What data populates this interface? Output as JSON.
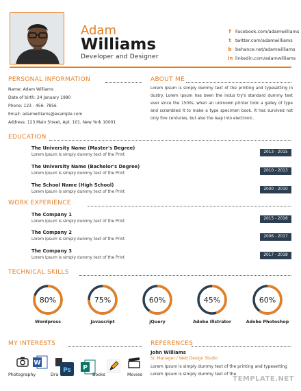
{
  "header": {
    "first_name": "Adam",
    "last_name": "Williams",
    "title": "Developer and Designer",
    "social": [
      {
        "icon": "facebook-icon",
        "glyph": "f",
        "text": "Facebook.com/adamwilliams"
      },
      {
        "icon": "twitter-icon",
        "glyph": "t",
        "text": "twitter.com/adamwilliams"
      },
      {
        "icon": "behance-icon",
        "glyph": "b",
        "text": "behance.net/adamwilliams"
      },
      {
        "icon": "linkedin-icon",
        "glyph": "in",
        "text": "linkedin.com/adamwilliams"
      }
    ]
  },
  "personal": {
    "heading": "PERSONAL INFORMATION",
    "lines": [
      "Name: Adam Williams",
      "Date of birth: 24 January 1980",
      "Phone: 123 - 456- 7856",
      "Email: adamwilliams@example.com",
      "Address:  123 Main Street, Apt. 101, New York 10001"
    ]
  },
  "about": {
    "heading": "ABOUT ME",
    "text": "Lorem Ipsum is simply dummy text of the printing and typesetting in dustry. Lorem Ipsum has been the indus try's standard dummy text ever since the 1500s, when an unknown printer took a galley of type and scrambled it to make a type specimen book. It has survived not only five centuries, but also the leap into electronic."
  },
  "education": {
    "heading": "EDUCATION",
    "items": [
      {
        "title": "The University Name (Master's Degree)",
        "desc": "Lorem Ipsum is simply dummy text of the Print",
        "years": "2013 - 2015"
      },
      {
        "title": "The University Name (Bachelor's Degree)",
        "desc": "Lorem Ipsum is simply dummy text of the Print",
        "years": "2010 - 2013"
      },
      {
        "title": "The School Name (High School)",
        "desc": "Lorem Ipsum is simply dummy text of the Print",
        "years": "2000 - 2010"
      }
    ]
  },
  "work": {
    "heading": "WORK EXPERIENCE",
    "items": [
      {
        "title": "The Company 1",
        "desc": "Lorem Ipsum is simply dummy text of the Print",
        "years": "2015 - 2016"
      },
      {
        "title": "The Company 2",
        "desc": "Lorem Ipsum is simply dummy text of the Print",
        "years": "2006 - 2017"
      },
      {
        "title": "The Company 3",
        "desc": "Lorem Ipsum is simply dummy text of the Print",
        "years": "2017 - 2018"
      }
    ]
  },
  "skills": {
    "heading": "TECHNICAL SKILLS",
    "items": [
      {
        "name": "Wordpress",
        "percent": 80,
        "label": "80%"
      },
      {
        "name": "Javascript",
        "percent": 75,
        "label": "75%"
      },
      {
        "name": "jQuery",
        "percent": 60,
        "label": "60%"
      },
      {
        "name": "Adobe Illstrator",
        "percent": 45,
        "label": "45%"
      },
      {
        "name": "Adobe Photoshop",
        "percent": 60,
        "label": "60%"
      }
    ],
    "ring_color": "#e67e22",
    "track_color": "#2c3e50"
  },
  "interests": {
    "heading": "MY INTERESTS",
    "items": [
      {
        "icon": "camera-icon",
        "label": "Photography"
      },
      {
        "icon": "word-icon",
        "label": "Dra"
      },
      {
        "icon": "photoshop-icon",
        "label": ""
      },
      {
        "icon": "publisher-icon",
        "label": "Books"
      },
      {
        "icon": "pencil-icon",
        "label": ""
      },
      {
        "icon": "movie-clapper-icon",
        "label": "Movies"
      }
    ]
  },
  "references": {
    "heading": "REFERENCES",
    "name": "John Williams",
    "role": "Sr. Manager / Web Design Studio",
    "lines": [
      "Lorem Ipsum is simply dummy text of the printing and typesetting",
      "Lorem Ipsum is simply dummy text of the"
    ]
  },
  "watermark": "TEMPLATE.NET",
  "colors": {
    "accent": "#e67e22",
    "dark": "#2c3e50"
  }
}
